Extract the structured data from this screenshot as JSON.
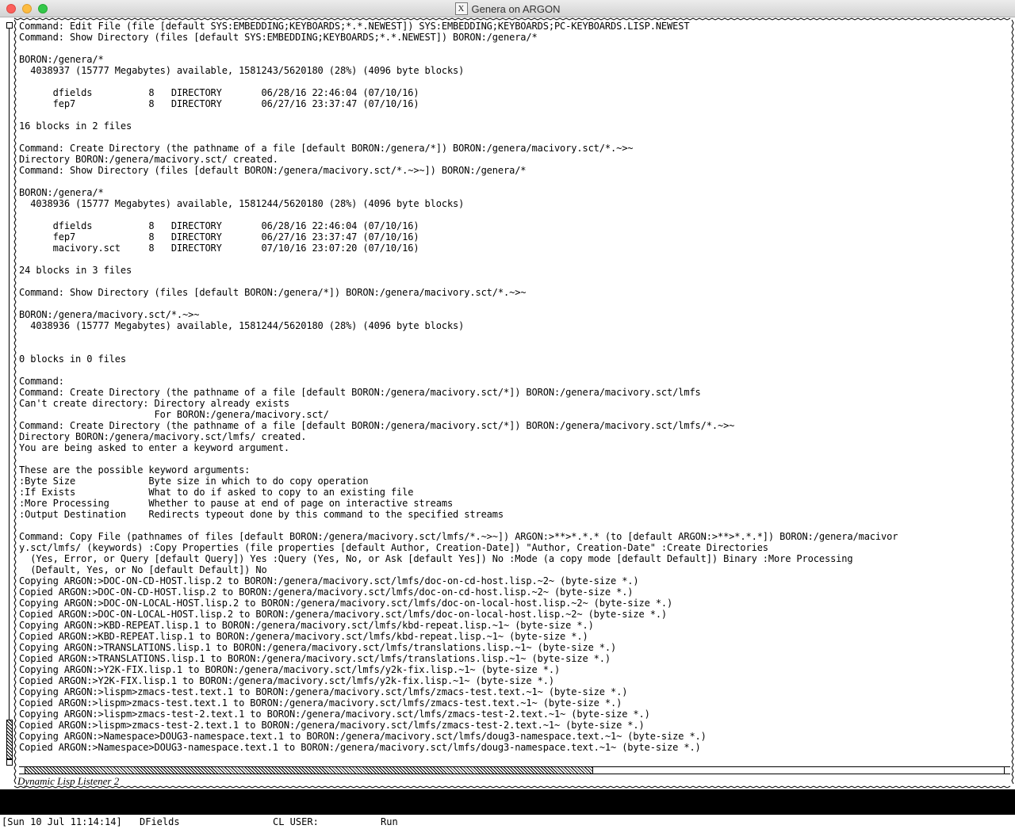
{
  "window": {
    "title": "Genera on ARGON",
    "x_icon_glyph": "X"
  },
  "listener": {
    "lines": [
      "Command: Edit File (file [default SYS:EMBEDDING;KEYBOARDS;*.*.NEWEST]) SYS:EMBEDDING;KEYBOARDS;PC-KEYBOARDS.LISP.NEWEST",
      "Command: Show Directory (files [default SYS:EMBEDDING;KEYBOARDS;*.*.NEWEST]) BORON:/genera/*",
      "",
      "BORON:/genera/*",
      "  4038937 (15777 Megabytes) available, 1581243/5620180 (28%) (4096 byte blocks)",
      "",
      "      dfields          8   DIRECTORY       06/28/16 22:46:04 (07/10/16)",
      "      fep7             8   DIRECTORY       06/27/16 23:37:47 (07/10/16)",
      "",
      "16 blocks in 2 files",
      "",
      "Command: Create Directory (the pathname of a file [default BORON:/genera/*]) BORON:/genera/macivory.sct/*.~>~",
      "Directory BORON:/genera/macivory.sct/ created.",
      "Command: Show Directory (files [default BORON:/genera/macivory.sct/*.~>~]) BORON:/genera/*",
      "",
      "BORON:/genera/*",
      "  4038936 (15777 Megabytes) available, 1581244/5620180 (28%) (4096 byte blocks)",
      "",
      "      dfields          8   DIRECTORY       06/28/16 22:46:04 (07/10/16)",
      "      fep7             8   DIRECTORY       06/27/16 23:37:47 (07/10/16)",
      "      macivory.sct     8   DIRECTORY       07/10/16 23:07:20 (07/10/16)",
      "",
      "24 blocks in 3 files",
      "",
      "Command: Show Directory (files [default BORON:/genera/*]) BORON:/genera/macivory.sct/*.~>~",
      "",
      "BORON:/genera/macivory.sct/*.~>~",
      "  4038936 (15777 Megabytes) available, 1581244/5620180 (28%) (4096 byte blocks)",
      "",
      "",
      "0 blocks in 0 files",
      "",
      "Command:",
      "Command: Create Directory (the pathname of a file [default BORON:/genera/macivory.sct/*]) BORON:/genera/macivory.sct/lmfs",
      "Can't create directory: Directory already exists",
      "                        For BORON:/genera/macivory.sct/",
      "Command: Create Directory (the pathname of a file [default BORON:/genera/macivory.sct/*]) BORON:/genera/macivory.sct/lmfs/*.~>~",
      "Directory BORON:/genera/macivory.sct/lmfs/ created.",
      "You are being asked to enter a keyword argument.",
      "",
      "These are the possible keyword arguments:",
      ":Byte Size             Byte size in which to do copy operation",
      ":If Exists             What to do if asked to copy to an existing file",
      ":More Processing       Whether to pause at end of page on interactive streams",
      ":Output Destination    Redirects typeout done by this command to the specified streams",
      "",
      "Command: Copy File (pathnames of files [default BORON:/genera/macivory.sct/lmfs/*.~>~]) ARGON:>**>*.*.* (to [default ARGON:>**>*.*.*]) BORON:/genera/macivor",
      "y.sct/lmfs/ (keywords) :Copy Properties (file properties [default Author, Creation-Date]) \"Author, Creation-Date\" :Create Directories",
      "  (Yes, Error, or Query [default Query]) Yes :Query (Yes, No, or Ask [default Yes]) No :Mode (a copy mode [default Default]) Binary :More Processing",
      "  (Default, Yes, or No [default Default]) No",
      "Copying ARGON:>DOC-ON-CD-HOST.lisp.2 to BORON:/genera/macivory.sct/lmfs/doc-on-cd-host.lisp.~2~ (byte-size *.)",
      "Copied ARGON:>DOC-ON-CD-HOST.lisp.2 to BORON:/genera/macivory.sct/lmfs/doc-on-cd-host.lisp.~2~ (byte-size *.)",
      "Copying ARGON:>DOC-ON-LOCAL-HOST.lisp.2 to BORON:/genera/macivory.sct/lmfs/doc-on-local-host.lisp.~2~ (byte-size *.)",
      "Copied ARGON:>DOC-ON-LOCAL-HOST.lisp.2 to BORON:/genera/macivory.sct/lmfs/doc-on-local-host.lisp.~2~ (byte-size *.)",
      "Copying ARGON:>KBD-REPEAT.lisp.1 to BORON:/genera/macivory.sct/lmfs/kbd-repeat.lisp.~1~ (byte-size *.)",
      "Copied ARGON:>KBD-REPEAT.lisp.1 to BORON:/genera/macivory.sct/lmfs/kbd-repeat.lisp.~1~ (byte-size *.)",
      "Copying ARGON:>TRANSLATIONS.lisp.1 to BORON:/genera/macivory.sct/lmfs/translations.lisp.~1~ (byte-size *.)",
      "Copied ARGON:>TRANSLATIONS.lisp.1 to BORON:/genera/macivory.sct/lmfs/translations.lisp.~1~ (byte-size *.)",
      "Copying ARGON:>Y2K-FIX.lisp.1 to BORON:/genera/macivory.sct/lmfs/y2k-fix.lisp.~1~ (byte-size *.)",
      "Copied ARGON:>Y2K-FIX.lisp.1 to BORON:/genera/macivory.sct/lmfs/y2k-fix.lisp.~1~ (byte-size *.)",
      "Copying ARGON:>lispm>zmacs-test.text.1 to BORON:/genera/macivory.sct/lmfs/zmacs-test.text.~1~ (byte-size *.)",
      "Copied ARGON:>lispm>zmacs-test.text.1 to BORON:/genera/macivory.sct/lmfs/zmacs-test.text.~1~ (byte-size *.)",
      "Copying ARGON:>lispm>zmacs-test-2.text.1 to BORON:/genera/macivory.sct/lmfs/zmacs-test-2.text.~1~ (byte-size *.)",
      "Copied ARGON:>lispm>zmacs-test-2.text.1 to BORON:/genera/macivory.sct/lmfs/zmacs-test-2.text.~1~ (byte-size *.)",
      "Copying ARGON:>Namespace>DOUG3-namespace.text.1 to BORON:/genera/macivory.sct/lmfs/doug3-namespace.text.~1~ (byte-size *.)",
      "Copied ARGON:>Namespace>DOUG3-namespace.text.1 to BORON:/genera/macivory.sct/lmfs/doug3-namespace.text.~1~ (byte-size *.)"
    ],
    "horizontal_scroll_fraction": 0.58
  },
  "pane_label": "Dynamic Lisp Listener 2",
  "status_line": {
    "datetime": "[Sun 10 Jul 11:14:14]",
    "user": "DFields",
    "package": "CL USER:",
    "state": "Run"
  }
}
